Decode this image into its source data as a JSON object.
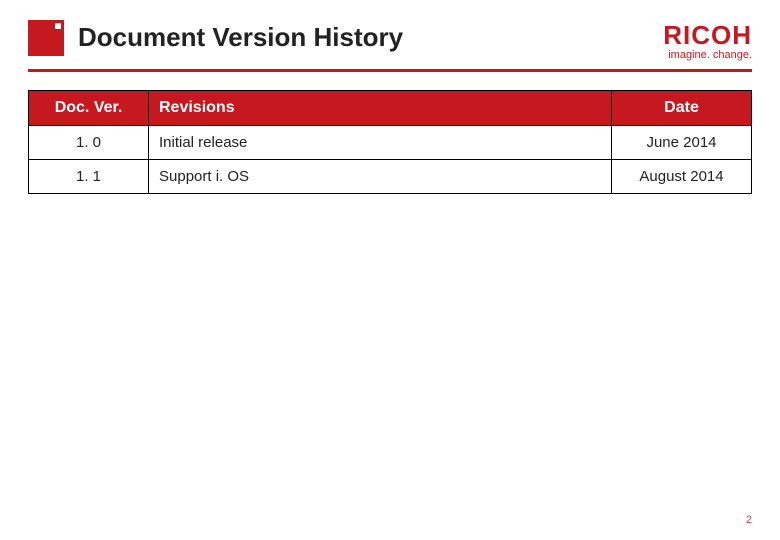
{
  "header": {
    "title": "Document Version History",
    "brand_name": "RICOH",
    "brand_tagline": "imagine. change."
  },
  "colors": {
    "accent": "#c6191f"
  },
  "table": {
    "headers": {
      "doc_ver": "Doc. Ver.",
      "revisions": "Revisions",
      "date": "Date"
    },
    "rows": [
      {
        "doc_ver": "1. 0",
        "revisions": "Initial release",
        "date": "June 2014"
      },
      {
        "doc_ver": "1. 1",
        "revisions": "Support i. OS",
        "date": "August 2014"
      }
    ]
  },
  "footer": {
    "page_number": "2"
  }
}
